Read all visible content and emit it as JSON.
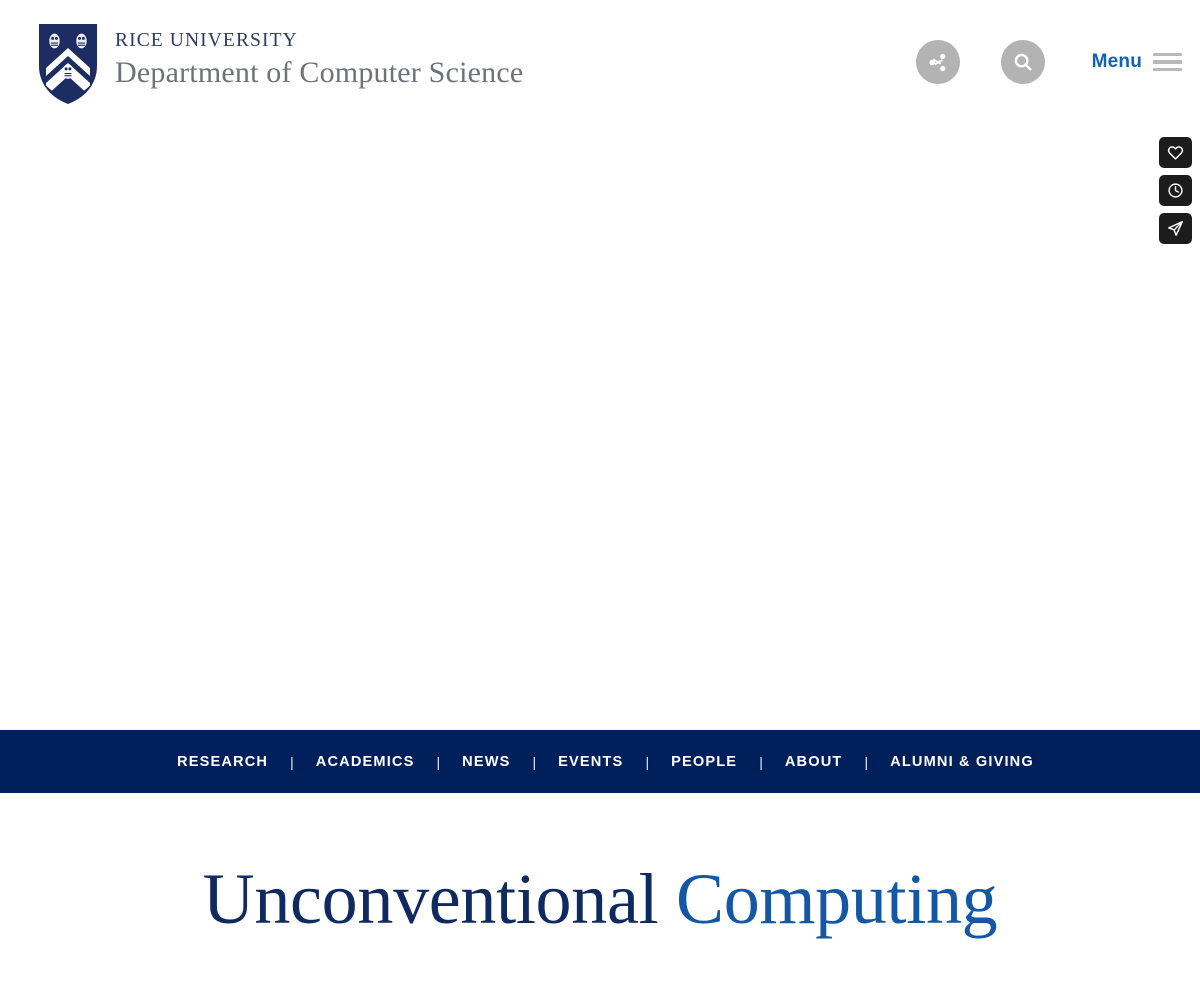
{
  "header": {
    "brand": {
      "logo_icon": "rice-owl-shield-icon",
      "university": "RICE UNIVERSITY",
      "department": "Department of Computer Science"
    },
    "tools": [
      {
        "name": "share-button",
        "icon": "share-icon",
        "label": "Share"
      },
      {
        "name": "search-button",
        "icon": "search-icon",
        "label": "Search"
      }
    ],
    "menu": {
      "label": "Menu",
      "icon": "hamburger-icon"
    }
  },
  "side_rail": [
    {
      "name": "favorite-button",
      "icon": "heart-icon",
      "label": "Favorite"
    },
    {
      "name": "history-button",
      "icon": "clock-icon",
      "label": "Recent"
    },
    {
      "name": "send-button",
      "icon": "paper-plane-icon",
      "label": "Send"
    }
  ],
  "nav": {
    "items": [
      {
        "label": "RESEARCH"
      },
      {
        "label": "ACADEMICS"
      },
      {
        "label": "NEWS"
      },
      {
        "label": "EVENTS"
      },
      {
        "label": "PEOPLE"
      },
      {
        "label": "ABOUT"
      },
      {
        "label": "ALUMNI & GIVING"
      }
    ],
    "separator": "|"
  },
  "main": {
    "title_part_one": "Unconventional",
    "title_part_two": "Computing"
  },
  "colors": {
    "navy": "#00205c",
    "brand_navy": "#2b3a67",
    "title_dark": "#0f2a5e",
    "title_accent": "#1357a5",
    "menu_blue": "#1062b4",
    "icon_circle_gray": "#b3b3b3",
    "rail_dark": "#1c1c1c",
    "department_gray": "#6f7279"
  }
}
